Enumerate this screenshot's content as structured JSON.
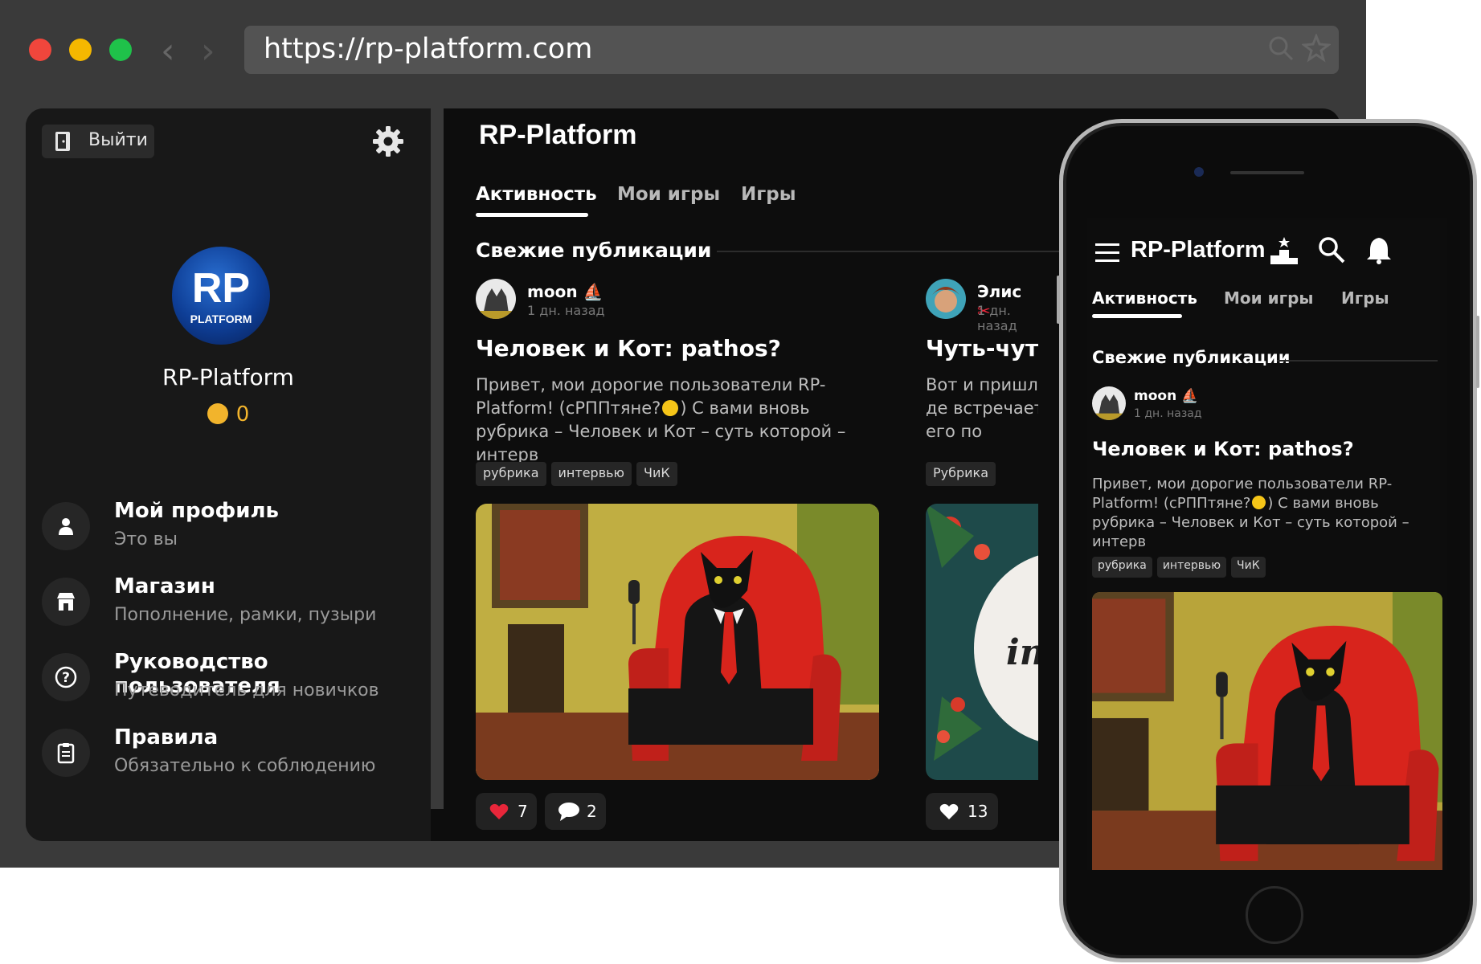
{
  "browser": {
    "url": "https://rp-platform.com",
    "traffic_lights": [
      "#f0463c",
      "#f5b800",
      "#1fc24a"
    ]
  },
  "sidebar": {
    "logout_label": "Выйти",
    "profile_name": "RP-Platform",
    "avatar_text": "RP",
    "avatar_subtext": "PLATFORM",
    "coin_balance": "0",
    "items": [
      {
        "title": "Мой профиль",
        "subtitle": "Это вы",
        "icon": "user-icon"
      },
      {
        "title": "Магазин",
        "subtitle": "Пополнение, рамки, пузыри",
        "icon": "shop-icon"
      },
      {
        "title": "Руководство пользователя",
        "subtitle": "Путеводитель для новичков",
        "icon": "help-icon"
      },
      {
        "title": "Правила",
        "subtitle": "Обязательно к соблюдению",
        "icon": "rules-icon"
      }
    ]
  },
  "main": {
    "app_title": "RP-Platform",
    "tabs": [
      "Активность",
      "Мои игры",
      "Игры"
    ],
    "section_title": "Свежие публикации",
    "posts": [
      {
        "author": "moon",
        "time": "1 дн. назад",
        "title": "Человек и Кот: pathos?",
        "text_part1": "Привет, мои дорогие пользователи RP-Platform! (сРППтяне?",
        "text_part2": ") С вами вновь рубрика – Человек и Кот – суть которой – интерв",
        "tags": [
          "рубрика",
          "интервью",
          "ЧиК"
        ],
        "likes": "7",
        "comments": "2"
      },
      {
        "author": "Элис",
        "time": "1 дн. назад",
        "title": "Чуть-чуть С",
        "text": "Вот и пришло де встречает его по солнышке, слуш",
        "tags": [
          "Рубрика"
        ],
        "likes": "13"
      }
    ]
  },
  "phone": {
    "app_title": "RP-Platform",
    "tabs": [
      "Активность",
      "Мои игры",
      "Игры"
    ],
    "section_title": "Свежие публикации",
    "post": {
      "author": "moon",
      "time": "1 дн. назад",
      "title": "Человек и Кот: pathos?",
      "text_part1": "Привет, мои дорогие пользователи RP-Platform! (сРППтяне?",
      "text_part2": ") С вами вновь рубрика – Человек и Кот – суть которой – интерв",
      "tags": [
        "рубрика",
        "интервью",
        "ЧиК"
      ]
    }
  },
  "colors": {
    "background": "#0d0d0d",
    "sidebar": "#181818",
    "coin": "#f2b42c",
    "like": "#e8263a",
    "tag_bg": "#262626"
  }
}
